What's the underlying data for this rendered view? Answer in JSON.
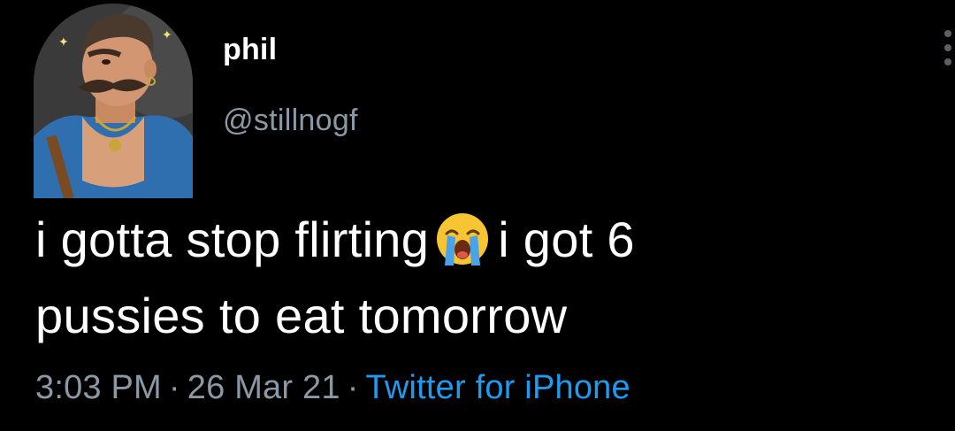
{
  "tweet": {
    "display_name": "phil",
    "handle": "@stillnogf",
    "text_line1_a": "i gotta stop flirting",
    "emoji": "loudly-crying-face-emoji",
    "text_line1_b": "i got 6",
    "text_line2": "pussies to eat tomorrow",
    "time": "3:03 PM",
    "separator": "·",
    "date": "26 Mar 21",
    "source": "Twitter for iPhone",
    "more_icon": "more-options-icon"
  },
  "colors": {
    "background": "#000000",
    "text": "#ffffff",
    "secondary": "#8b98a5",
    "link": "#1d9bf0"
  }
}
